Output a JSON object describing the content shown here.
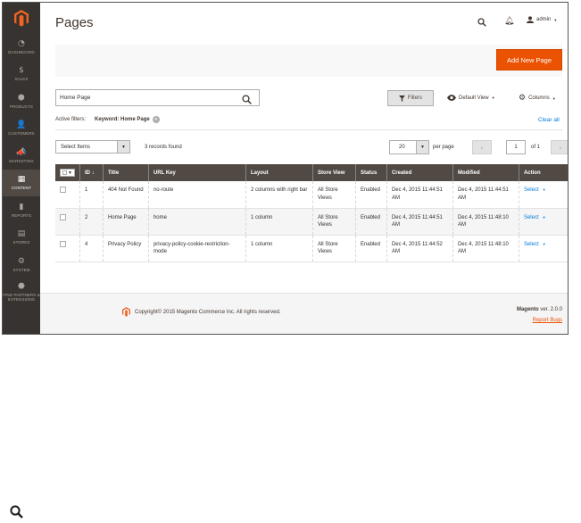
{
  "sidebar": {
    "items": [
      {
        "label": "DASHBOARD",
        "icon": "dashboard-icon",
        "glyph": "◔"
      },
      {
        "label": "SALES",
        "icon": "dollar-icon",
        "glyph": "$"
      },
      {
        "label": "PRODUCTS",
        "icon": "cube-icon",
        "glyph": "⬢"
      },
      {
        "label": "CUSTOMERS",
        "icon": "person-icon",
        "glyph": "👤"
      },
      {
        "label": "MARKETING",
        "icon": "megaphone-icon",
        "glyph": "📣"
      },
      {
        "label": "CONTENT",
        "icon": "layout-icon",
        "glyph": "▦",
        "active": true
      },
      {
        "label": "REPORTS",
        "icon": "bar-chart-icon",
        "glyph": "▮"
      },
      {
        "label": "STORES",
        "icon": "store-icon",
        "glyph": "▤"
      },
      {
        "label": "SYSTEM",
        "icon": "gear-icon",
        "glyph": "⚙"
      },
      {
        "label": "FIND PARTNERS & EXTENSIONS",
        "icon": "puzzle-icon",
        "glyph": "⬣"
      }
    ]
  },
  "header": {
    "title": "Pages",
    "user": "admin"
  },
  "actions": {
    "add_new": "Add New Page"
  },
  "search": {
    "value": "Home Page"
  },
  "toolbar": {
    "filters": "Filters",
    "default_view": "Default View",
    "columns": "Columns"
  },
  "active_filters": {
    "label": "Active filters:",
    "keyword": "Keyword: Home Page",
    "clear_all": "Clear all"
  },
  "grid_controls": {
    "mass_action": "Select Items",
    "records_found": "3 records found",
    "per_page": "20",
    "per_page_label": "per page",
    "current_page": "1",
    "of_pages": "of 1"
  },
  "table": {
    "columns": [
      "ID",
      "Title",
      "URL Key",
      "Layout",
      "Store View",
      "Status",
      "Created",
      "Modified",
      "Action"
    ],
    "rows": [
      {
        "id": "1",
        "title": "404 Not Found",
        "url_key": "no-route",
        "layout": "2 columns with right bar",
        "store_view": "All Store Views",
        "status": "Enabled",
        "created": "Dec 4, 2015 11:44:51 AM",
        "modified": "Dec 4, 2015 11:44:51 AM",
        "action": "Select"
      },
      {
        "id": "2",
        "title": "Home Page",
        "url_key": "home",
        "layout": "1 column",
        "store_view": "All Store Views",
        "status": "Enabled",
        "created": "Dec 4, 2015 11:44:51 AM",
        "modified": "Dec 4, 2015 11:48:10 AM",
        "action": "Select"
      },
      {
        "id": "4",
        "title": "Privacy Policy",
        "url_key": "privacy-policy-cookie-restriction-mode",
        "layout": "1 column",
        "store_view": "All Store Views",
        "status": "Enabled",
        "created": "Dec 4, 2015 11:44:52 AM",
        "modified": "Dec 4, 2015 11:48:10 AM",
        "action": "Select"
      }
    ]
  },
  "footer": {
    "copyright": "Copyright© 2015 Magento Commerce Inc. All rights reserved.",
    "brand": "Magento",
    "version": "ver. 2.0.0",
    "report_bugs": "Report Bugs"
  },
  "colors": {
    "accent": "#eb5202",
    "sidebar": "#373330",
    "table_header": "#514943",
    "link": "#007bdb"
  }
}
